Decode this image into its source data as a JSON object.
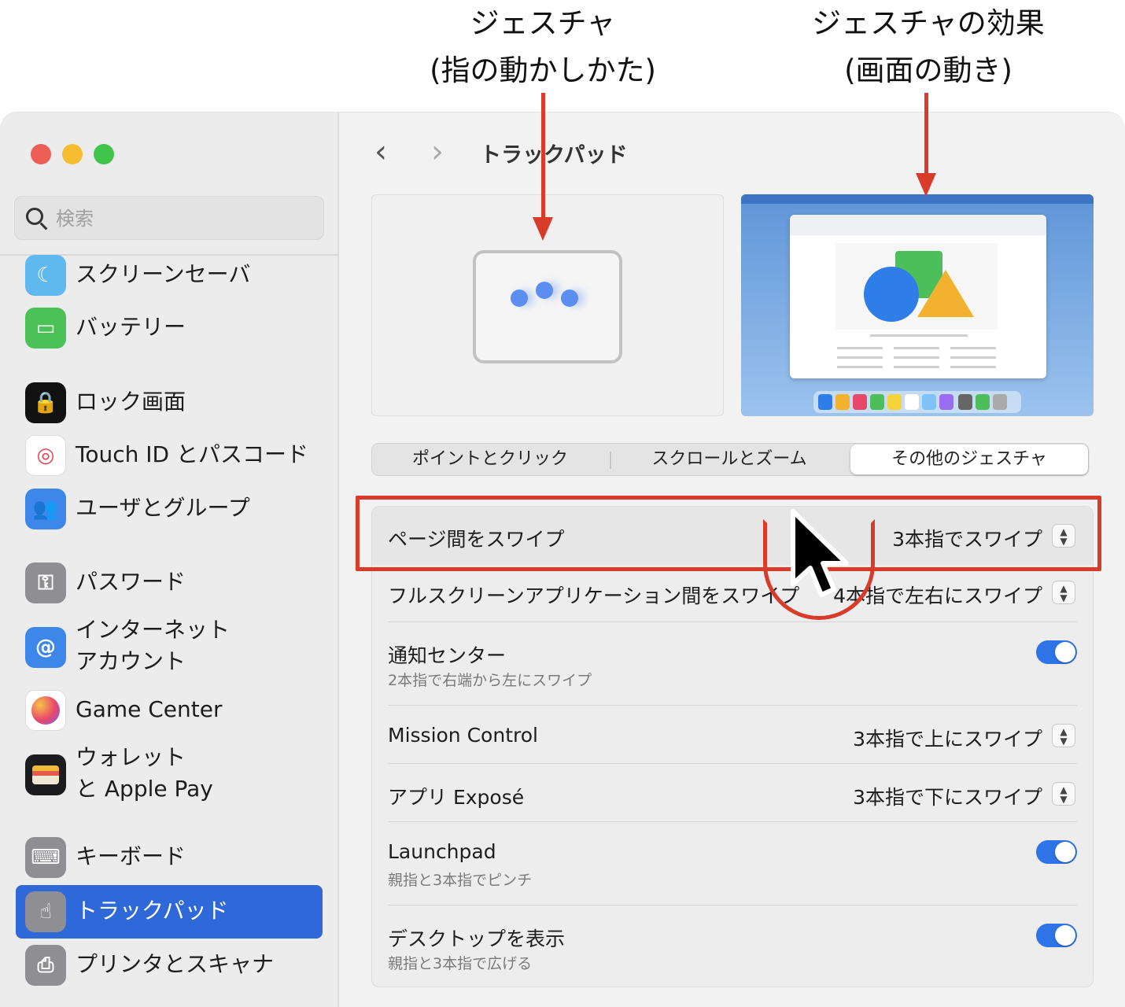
{
  "annotations": {
    "gesture_line1": "ジェスチャ",
    "gesture_line2": "(指の動かしかた)",
    "effect_line1": "ジェスチャの効果",
    "effect_line2": "(画面の動き)"
  },
  "window": {
    "title": "トラックパッド",
    "back_icon": "chevron-left-icon",
    "forward_icon": "chevron-right-icon",
    "traffic_colors": {
      "close": "#ec5f57",
      "minimize": "#f5bd2f",
      "zoom": "#3fc64a"
    }
  },
  "search": {
    "placeholder": "検索"
  },
  "sidebar": {
    "items": [
      {
        "label": "スクリーンセーバ",
        "icon": "screensaver-icon"
      },
      {
        "label": "バッテリー",
        "icon": "battery-icon"
      },
      {
        "label": "ロック画面",
        "icon": "lock-icon"
      },
      {
        "label": "Touch ID とパスコード",
        "icon": "fingerprint-icon"
      },
      {
        "label": "ユーザとグループ",
        "icon": "users-icon"
      },
      {
        "label": "パスワード",
        "icon": "key-icon"
      },
      {
        "label": "インターネット",
        "label2": "アカウント",
        "icon": "at-icon"
      },
      {
        "label": "Game Center",
        "icon": "game-center-icon"
      },
      {
        "label": "ウォレット",
        "label2": "と Apple Pay",
        "icon": "wallet-icon"
      },
      {
        "label": "キーボード",
        "icon": "keyboard-icon"
      },
      {
        "label": "トラックパッド",
        "icon": "trackpad-icon",
        "selected": true
      },
      {
        "label": "プリンタとスキャナ",
        "icon": "printer-icon"
      }
    ],
    "selected_color": "#2f68d8"
  },
  "tabs": [
    {
      "label": "ポイントとクリック",
      "active": false
    },
    {
      "label": "スクロールとズーム",
      "active": false
    },
    {
      "label": "その他のジェスチャ",
      "active": true
    }
  ],
  "settings": [
    {
      "label": "ページ間をスワイプ",
      "value": "3本指でスワイプ",
      "control": "popup"
    },
    {
      "label": "フルスクリーンアプリケーション間をスワイプ",
      "value": "4本指で左右にスワイプ",
      "control": "popup"
    },
    {
      "label": "通知センター",
      "sub": "2本指で右端から左にスワイプ",
      "control": "toggle",
      "on": true
    },
    {
      "label": "Mission Control",
      "value": "3本指で上にスワイプ",
      "control": "popup"
    },
    {
      "label": "アプリ Exposé",
      "value": "3本指で下にスワイプ",
      "control": "popup"
    },
    {
      "label": "Launchpad",
      "sub": "親指と3本指でピンチ",
      "control": "toggle",
      "on": true
    },
    {
      "label": "デスクトップを表示",
      "sub": "親指と3本指で広げる",
      "control": "toggle",
      "on": true
    }
  ],
  "highlight_color": "#d93b2b"
}
